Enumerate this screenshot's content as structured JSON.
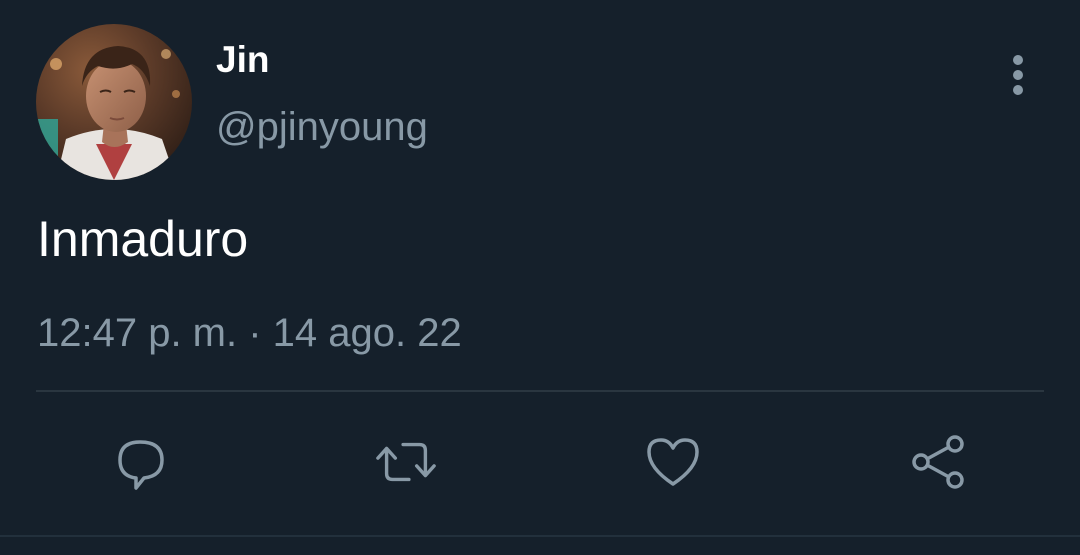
{
  "tweet": {
    "display_name": "Jin",
    "handle": "@pjinyoung",
    "text": "Inmaduro",
    "timestamp": "12:47 p. m. · 14 ago. 22"
  },
  "icons": {
    "more": "more-vertical-icon",
    "reply": "reply-bubble-icon",
    "retweet": "retweet-icon",
    "like": "heart-icon",
    "share": "share-icon"
  },
  "colors": {
    "background": "#15202b",
    "primary_text": "#ffffff",
    "secondary_text": "#8899a6",
    "divider": "#2a3640"
  }
}
